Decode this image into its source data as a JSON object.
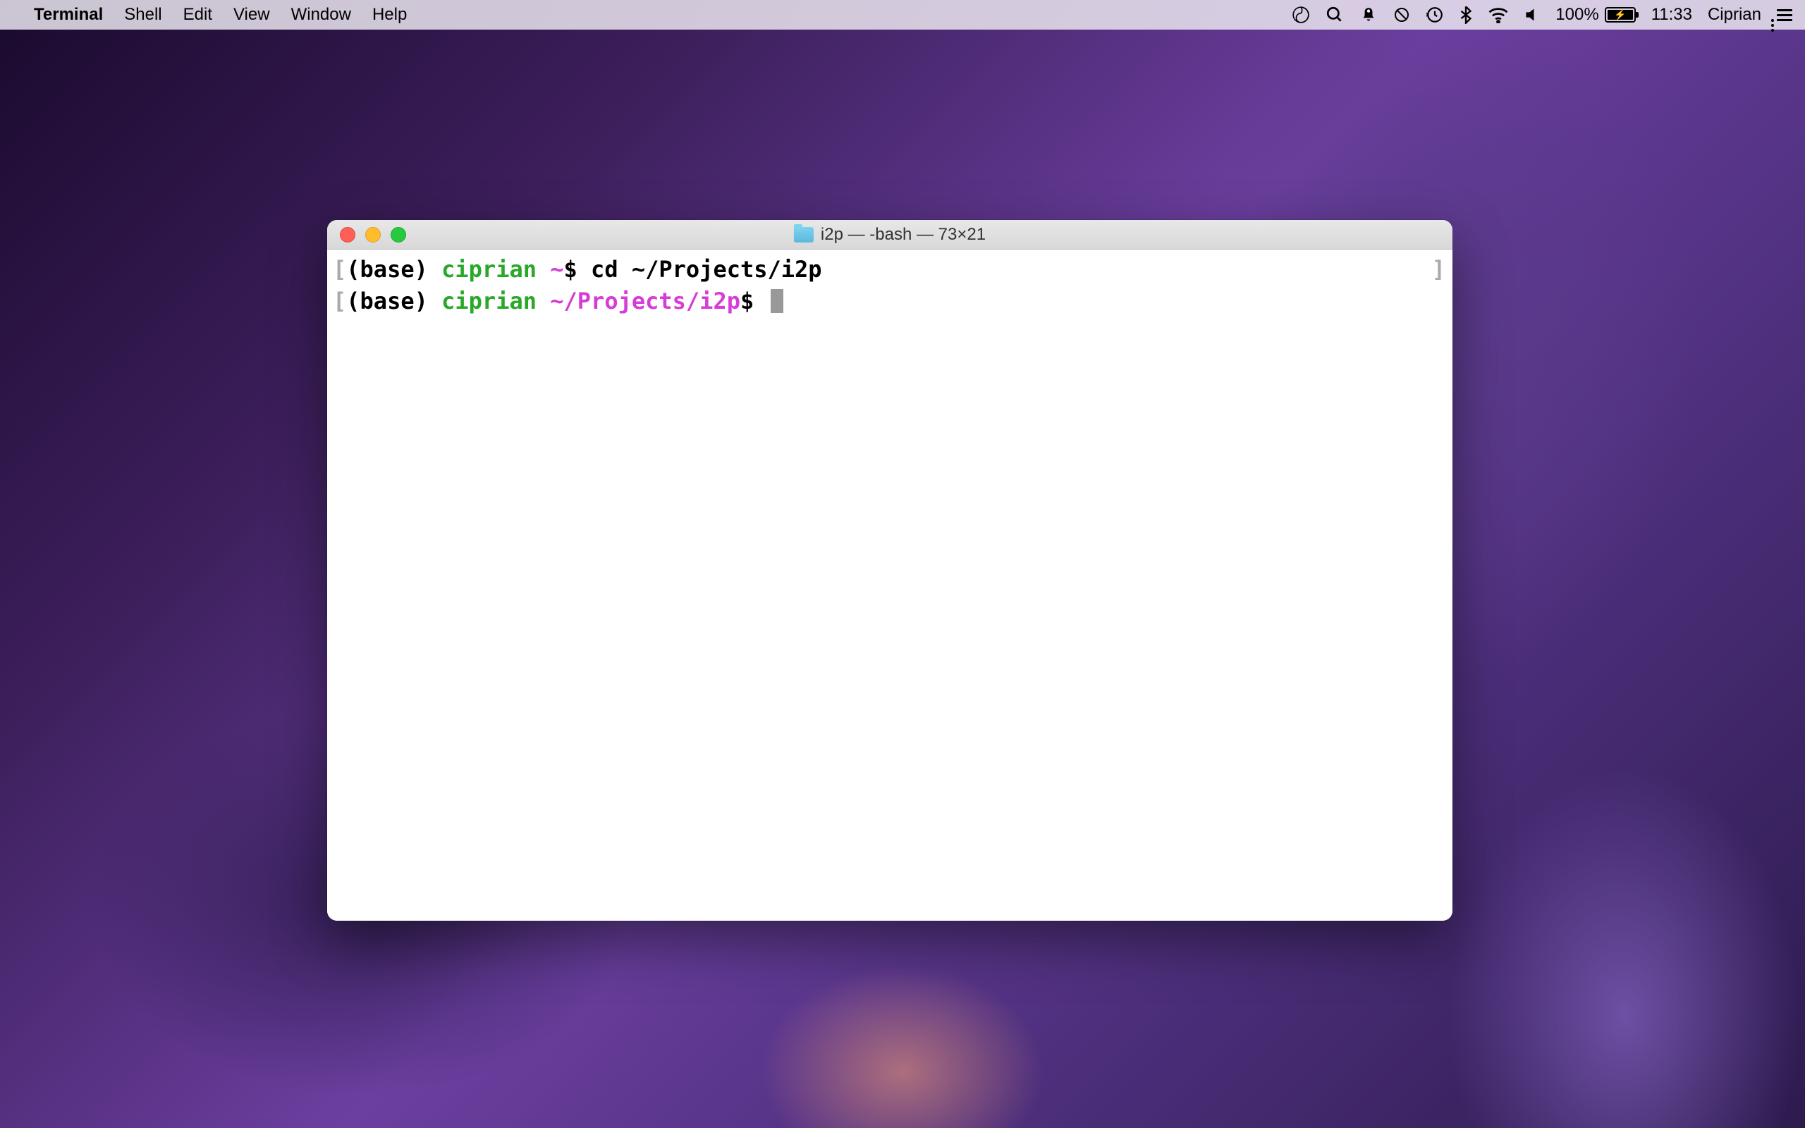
{
  "menubar": {
    "app_name": "Terminal",
    "menus": [
      "Shell",
      "Edit",
      "View",
      "Window",
      "Help"
    ],
    "status": {
      "battery_percent": "100%",
      "time": "11:33",
      "username": "Ciprian"
    }
  },
  "terminal": {
    "window_title": "i2p — -bash — 73×21",
    "lines": [
      {
        "base": "(base) ",
        "user": "ciprian",
        "path": " ~",
        "dollar": "$",
        "command": " cd ~/Projects/i2p"
      },
      {
        "base": "(base) ",
        "user": "ciprian",
        "path": " ~/Projects/i2p",
        "dollar": "$",
        "command": " "
      }
    ]
  }
}
